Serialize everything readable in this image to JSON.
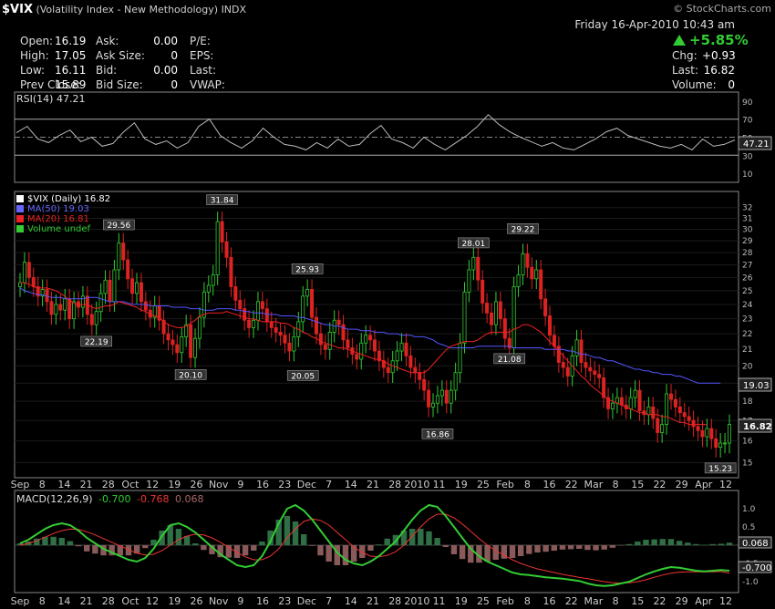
{
  "header": {
    "symbol": "$VIX",
    "name": "(Volatility Index - New Methodology)",
    "exchange": "INDX",
    "datetime": "Friday 16-Apr-2010 10:43 am",
    "change_pct": "+5.85%",
    "watermark": "© StockCharts.com"
  },
  "quote": {
    "open_label": "Open:",
    "open": "16.19",
    "high_label": "High:",
    "high": "17.05",
    "low_label": "Low:",
    "low": "16.11",
    "prev_label": "Prev Close:",
    "prev": "15.89",
    "ask_label": "Ask:",
    "ask": "0.00",
    "asksize_label": "Ask Size:",
    "asksize": "0",
    "bid_label": "Bid:",
    "bid": "0.00",
    "bidsize_label": "Bid Size:",
    "bidsize": "0",
    "pe_label": "P/E:",
    "eps_label": "EPS:",
    "last_label_l": "Last:",
    "vwap_label": "VWAP:",
    "chg_label": "Chg:",
    "chg": "+0.93",
    "last_label": "Last:",
    "last": "16.82",
    "volume_label": "Volume:",
    "volume": "0"
  },
  "colors": {
    "up": "#33cc33",
    "down": "#dd2222",
    "ma50": "#5555ff",
    "ma20": "#ee2222",
    "macd": "#33cc33",
    "signal": "#ee3333",
    "hist": "#aa6666",
    "rsi": "#bbbbbb"
  },
  "chart_data": [
    {
      "type": "line",
      "panel": "RSI",
      "legend": "RSI(14) 47.21",
      "last_label": "47.21",
      "yticks": [
        10,
        30,
        50,
        70,
        90
      ],
      "ylim": [
        0,
        100
      ],
      "levels": [
        30,
        70
      ],
      "x": [
        0,
        4,
        8,
        12,
        16,
        20,
        24,
        28,
        32,
        36,
        40,
        44,
        48,
        52,
        56,
        60,
        64,
        68,
        72,
        76,
        80,
        84,
        88,
        92,
        96,
        100,
        104,
        108,
        112,
        116,
        120,
        124,
        128,
        132,
        136,
        140,
        144,
        148,
        152,
        156
      ],
      "values": [
        55,
        62,
        48,
        44,
        52,
        58,
        45,
        50,
        40,
        43,
        56,
        66,
        48,
        42,
        46,
        38,
        44,
        62,
        70,
        52,
        44,
        38,
        46,
        60,
        50,
        42,
        40,
        36,
        44,
        38,
        48,
        40,
        42,
        54,
        63,
        48,
        44,
        38,
        50,
        42,
        36,
        44,
        52,
        62,
        75,
        64,
        56,
        50,
        45,
        40,
        44,
        38,
        36,
        42,
        48,
        56,
        60,
        52,
        48,
        44,
        40,
        38,
        42,
        36,
        48,
        40,
        42,
        47
      ]
    },
    {
      "type": "candlestick",
      "panel": "Price",
      "legend": [
        {
          "label": "$VIX (Daily) 16.82",
          "color": "#ffffff"
        },
        {
          "label": "MA(50) 19.03",
          "color": "#6666ff"
        },
        {
          "label": "MA(20) 16.81",
          "color": "#ee2222"
        },
        {
          "label": "Volume undef",
          "color": "#33cc33"
        }
      ],
      "ylim": [
        14.5,
        32.5
      ],
      "log_scale": true,
      "yticks": [
        15,
        16,
        17,
        18,
        19,
        20,
        21,
        22,
        23,
        24,
        25,
        26,
        27,
        28,
        29,
        30,
        31,
        32
      ],
      "xticks": [
        "Sep",
        "8",
        "14",
        "21",
        "28",
        "Oct",
        "12",
        "19",
        "26",
        "Nov",
        "9",
        "16",
        "23",
        "Dec",
        "7",
        "14",
        "21",
        "28",
        "2010",
        "11",
        "19",
        "25",
        "Feb",
        "8",
        "16",
        "22",
        "Mar",
        "8",
        "15",
        "22",
        "29",
        "Apr",
        "12"
      ],
      "ma50_label": "19.03",
      "last_label": "16.82",
      "annotations": [
        {
          "label": "29.56",
          "bar": 22
        },
        {
          "label": "22.19",
          "bar": 17
        },
        {
          "label": "31.84",
          "bar": 45
        },
        {
          "label": "20.10",
          "bar": 38
        },
        {
          "label": "25.93",
          "bar": 64
        },
        {
          "label": "20.05",
          "bar": 63
        },
        {
          "label": "16.86",
          "bar": 93
        },
        {
          "label": "28.01",
          "bar": 101
        },
        {
          "label": "29.22",
          "bar": 112
        },
        {
          "label": "21.08",
          "bar": 109
        },
        {
          "label": "15.23",
          "bar": 156
        }
      ],
      "closes": [
        25.6,
        27.2,
        26.0,
        25.3,
        24.6,
        25.1,
        24.2,
        23.3,
        24.0,
        23.6,
        24.4,
        23.0,
        24.2,
        23.8,
        24.6,
        23.3,
        22.6,
        23.5,
        24.8,
        25.8,
        24.2,
        26.6,
        28.8,
        27.4,
        25.9,
        24.8,
        25.6,
        24.2,
        23.6,
        23.1,
        23.9,
        22.9,
        22.0,
        21.6,
        21.3,
        20.8,
        21.8,
        22.6,
        20.5,
        21.7,
        23.1,
        24.9,
        25.4,
        26.2,
        30.7,
        28.9,
        27.6,
        25.3,
        24.3,
        23.7,
        22.9,
        22.4,
        22.9,
        24.2,
        23.7,
        22.8,
        22.4,
        22.1,
        21.9,
        21.4,
        20.9,
        21.8,
        22.8,
        24.6,
        25.1,
        23.1,
        22.0,
        21.3,
        21.0,
        22.1,
        22.9,
        22.6,
        21.6,
        21.1,
        20.7,
        20.4,
        21.4,
        21.9,
        21.6,
        20.9,
        20.3,
        19.9,
        19.6,
        20.3,
        20.9,
        21.4,
        20.6,
        19.9,
        19.6,
        19.2,
        18.6,
        17.7,
        17.9,
        18.3,
        18.6,
        17.9,
        18.6,
        19.6,
        21.4,
        24.9,
        26.6,
        27.6,
        25.8,
        24.1,
        23.4,
        22.6,
        24.2,
        23.0,
        21.7,
        21.1,
        25.3,
        26.2,
        27.9,
        26.8,
        25.9,
        26.6,
        24.4,
        23.2,
        21.9,
        21.2,
        20.2,
        19.9,
        19.4,
        20.6,
        21.6,
        20.2,
        19.9,
        19.7,
        19.5,
        19.3,
        18.2,
        17.6,
        17.9,
        18.2,
        17.8,
        17.6,
        18.2,
        18.6,
        17.5,
        17.3,
        17.7,
        17.1,
        16.4,
        16.8,
        18.4,
        18.1,
        17.7,
        17.4,
        17.2,
        17.0,
        16.7,
        16.5,
        16.2,
        16.6,
        16.1,
        15.7,
        15.9,
        15.9,
        16.8
      ],
      "ma50": [
        25.2,
        25.0,
        24.9,
        24.8,
        24.7,
        24.7,
        24.6,
        24.5,
        24.5,
        24.5,
        24.4,
        24.4,
        24.4,
        24.4,
        24.4,
        24.5,
        24.5,
        24.5,
        24.4,
        24.3,
        24.2,
        24.2,
        24.2,
        24.2,
        24.1,
        24.0,
        24.0,
        24.0,
        24.0,
        23.9,
        23.9,
        23.9,
        23.9,
        23.9,
        23.8,
        23.8,
        23.8,
        23.8,
        23.7,
        23.7,
        23.7,
        23.6,
        23.6,
        23.6,
        23.7,
        23.7,
        23.7,
        23.7,
        23.6,
        23.6,
        23.5,
        23.5,
        23.4,
        23.4,
        23.4,
        23.3,
        23.3,
        23.3,
        23.2,
        23.2,
        23.2,
        23.2,
        23.1,
        23.1,
        23.0,
        22.9,
        22.8,
        22.7,
        22.6,
        22.6,
        22.5,
        22.5,
        22.4,
        22.3,
        22.3,
        22.3,
        22.2,
        22.2,
        22.2,
        22.1,
        22.1,
        22.1,
        22.0,
        22.0,
        22.0,
        21.9,
        21.9,
        21.9,
        21.8,
        21.8,
        21.8,
        21.7,
        21.6,
        21.4,
        21.3,
        21.2,
        21.1,
        21.1,
        21.1,
        21.1,
        21.1,
        21.1,
        21.2,
        21.2,
        21.2,
        21.2,
        21.2,
        21.2,
        21.2,
        21.2,
        21.1,
        21.1,
        21.1,
        21.1,
        21.1,
        21.1,
        21.1,
        21.0,
        21.0,
        21.0,
        21.0,
        21.0,
        20.9,
        20.9,
        20.8,
        20.7,
        20.7,
        20.6,
        20.5,
        20.5,
        20.4,
        20.3,
        20.3,
        20.2,
        20.1,
        20.0,
        19.9,
        19.8,
        19.8,
        19.7,
        19.7,
        19.6,
        19.6,
        19.5,
        19.5,
        19.5,
        19.4,
        19.4,
        19.3,
        19.2,
        19.1,
        19.0,
        19.0,
        19.0,
        19.0,
        19.0,
        19.0
      ],
      "ma20": [
        25.6,
        25.6,
        25.5,
        25.3,
        25.2,
        25.2,
        25.2,
        25.1,
        25.0,
        24.8,
        24.6,
        24.3,
        24.1,
        23.9,
        24.0,
        24.0,
        23.8,
        23.7,
        23.8,
        23.9,
        23.9,
        24.0,
        24.2,
        24.1,
        24.0,
        23.9,
        23.8,
        23.6,
        23.5,
        23.3,
        23.2,
        23.1,
        22.8,
        22.6,
        22.5,
        22.4,
        22.4,
        22.5,
        22.7,
        22.9,
        23.2,
        23.3,
        23.4,
        23.4,
        23.4,
        23.4,
        23.5,
        23.4,
        23.3,
        23.2,
        23.1,
        23.0,
        23.0,
        22.9,
        22.8,
        22.8,
        22.8,
        22.8,
        22.7,
        22.7,
        22.6,
        22.4,
        22.3,
        22.1,
        22.0,
        21.8,
        21.7,
        21.5,
        21.4,
        21.3,
        21.2,
        21.1,
        21.1,
        21.0,
        20.9,
        20.8,
        20.7,
        20.6,
        20.5,
        20.4,
        20.4,
        20.3,
        20.1,
        20.0,
        19.9,
        19.8,
        19.7,
        19.6,
        19.6,
        19.6,
        19.6,
        19.8,
        20.1,
        20.4,
        20.7,
        21.0,
        21.2,
        21.3,
        21.4,
        21.5,
        21.5,
        21.5,
        21.6,
        21.8,
        22.0,
        22.1,
        22.1,
        22.1,
        22.1,
        22.1,
        22.3,
        22.4,
        22.6,
        22.6,
        22.5,
        22.3,
        22.1,
        21.8,
        21.5,
        21.2,
        20.9,
        20.6,
        20.3,
        20.0,
        19.7,
        19.4,
        19.2,
        18.9,
        18.7,
        18.5,
        18.3,
        18.1,
        18.0,
        17.9,
        17.8,
        17.7,
        17.6,
        17.5,
        17.4,
        17.4,
        17.3,
        17.3,
        17.3,
        17.2,
        17.2,
        17.1,
        17.0,
        16.9,
        16.9,
        16.8,
        16.8,
        16.8,
        16.8,
        16.8
      ]
    },
    {
      "type": "line",
      "panel": "MACD",
      "legend_main": "MACD(12,26,9)",
      "legend_macd": "-0.700",
      "legend_signal": "-0.768",
      "legend_hist": "0.068",
      "label_macd": "-0.700",
      "label_hist": "0.068",
      "yticks": [
        -1.0,
        -0.5,
        0.5,
        1.0
      ],
      "ylim": [
        -1.25,
        1.45
      ],
      "xticks": [
        "Sep",
        "8",
        "14",
        "21",
        "28",
        "Oct",
        "12",
        "19",
        "26",
        "Nov",
        "9",
        "16",
        "23",
        "Dec",
        "7",
        "14",
        "21",
        "28",
        "2010",
        "11",
        "19",
        "25",
        "Feb",
        "8",
        "16",
        "22",
        "Mar",
        "8",
        "15",
        "22",
        "29",
        "Apr",
        "12"
      ],
      "macd_values": [
        0.05,
        0.15,
        0.3,
        0.45,
        0.55,
        0.6,
        0.55,
        0.4,
        0.2,
        0.05,
        -0.1,
        -0.2,
        -0.3,
        -0.4,
        -0.45,
        -0.35,
        -0.1,
        0.25,
        0.55,
        0.6,
        0.5,
        0.35,
        0.15,
        -0.05,
        -0.25,
        -0.4,
        -0.55,
        -0.6,
        -0.55,
        -0.3,
        0.1,
        0.6,
        1.0,
        1.1,
        0.95,
        0.7,
        0.4,
        0.1,
        -0.2,
        -0.4,
        -0.5,
        -0.55,
        -0.45,
        -0.3,
        -0.1,
        0.1,
        0.4,
        0.7,
        0.95,
        1.1,
        1.05,
        0.8,
        0.5,
        0.2,
        -0.1,
        -0.3,
        -0.45,
        -0.55,
        -0.65,
        -0.75,
        -0.8,
        -0.82,
        -0.85,
        -0.88,
        -0.9,
        -0.92,
        -0.95,
        -0.98,
        -1.05,
        -1.1,
        -1.12,
        -1.1,
        -1.05,
        -1.0,
        -0.9,
        -0.8,
        -0.72,
        -0.65,
        -0.6,
        -0.62,
        -0.66,
        -0.7,
        -0.72,
        -0.7,
        -0.68,
        -0.7
      ],
      "signal_values": [
        0.0,
        0.05,
        0.12,
        0.22,
        0.32,
        0.4,
        0.44,
        0.43,
        0.37,
        0.28,
        0.18,
        0.08,
        -0.02,
        -0.12,
        -0.22,
        -0.27,
        -0.25,
        -0.15,
        0.0,
        0.15,
        0.25,
        0.3,
        0.28,
        0.2,
        0.08,
        -0.06,
        -0.2,
        -0.32,
        -0.4,
        -0.4,
        -0.3,
        -0.1,
        0.2,
        0.45,
        0.65,
        0.72,
        0.68,
        0.55,
        0.35,
        0.15,
        -0.05,
        -0.2,
        -0.3,
        -0.32,
        -0.28,
        -0.18,
        0.0,
        0.25,
        0.5,
        0.72,
        0.85,
        0.85,
        0.75,
        0.58,
        0.38,
        0.18,
        0.0,
        -0.15,
        -0.28,
        -0.4,
        -0.5,
        -0.58,
        -0.65,
        -0.7,
        -0.75,
        -0.8,
        -0.84,
        -0.88,
        -0.92,
        -0.96,
        -1.0,
        -1.03,
        -1.04,
        -1.03,
        -1.0,
        -0.95,
        -0.88,
        -0.82,
        -0.77,
        -0.74,
        -0.73,
        -0.73,
        -0.73,
        -0.73,
        -0.72,
        -0.768
      ],
      "histogram": [
        0.05,
        0.1,
        0.18,
        0.23,
        0.23,
        0.2,
        0.11,
        -0.03,
        -0.17,
        -0.23,
        -0.28,
        -0.28,
        -0.28,
        -0.28,
        -0.23,
        -0.08,
        0.15,
        0.4,
        0.55,
        0.45,
        0.25,
        0.05,
        -0.13,
        -0.25,
        -0.33,
        -0.34,
        -0.35,
        -0.28,
        -0.15,
        0.1,
        0.4,
        0.7,
        0.8,
        0.65,
        0.3,
        -0.02,
        -0.28,
        -0.45,
        -0.55,
        -0.55,
        -0.45,
        -0.35,
        -0.15,
        0.02,
        0.18,
        0.28,
        0.4,
        0.45,
        0.45,
        0.38,
        0.2,
        -0.05,
        -0.25,
        -0.38,
        -0.48,
        -0.48,
        -0.45,
        -0.4,
        -0.37,
        -0.35,
        -0.3,
        -0.24,
        -0.2,
        -0.18,
        -0.15,
        -0.12,
        -0.11,
        -0.1,
        -0.13,
        -0.14,
        -0.12,
        -0.07,
        -0.01,
        0.03,
        0.1,
        0.15,
        0.16,
        0.17,
        0.17,
        0.12,
        0.07,
        0.03,
        0.01,
        0.03,
        0.04,
        0.068
      ]
    }
  ]
}
